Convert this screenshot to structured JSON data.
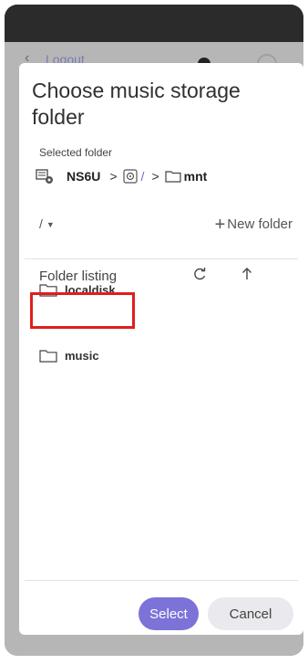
{
  "background": {
    "back_glyph": "‹",
    "logout_label": "Logout"
  },
  "dialog": {
    "title": "Choose music storage folder",
    "selected_label": "Selected folder",
    "path": {
      "nas_name": "NS6U",
      "sep1": ">",
      "root_slash": "/",
      "sep2": ">",
      "folder": "mnt"
    },
    "root_select": "/",
    "new_folder_label": "New folder",
    "listing_header": "Folder listing",
    "folders": [
      "localdisk",
      "music"
    ],
    "select_label": "Select",
    "cancel_label": "Cancel"
  },
  "colors": {
    "accent": "#7b73d8",
    "highlight": "#e01e1e"
  }
}
